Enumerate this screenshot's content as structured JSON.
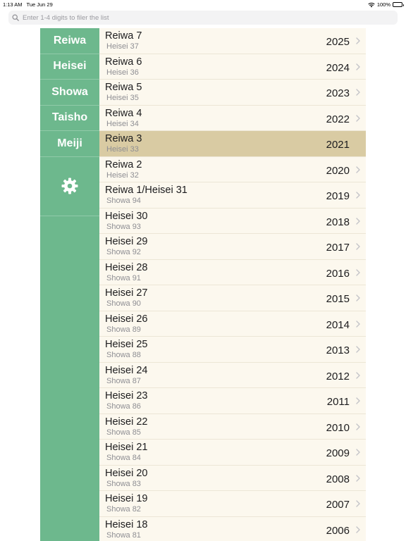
{
  "status": {
    "time": "1:13 AM",
    "date": "Tue Jun 29",
    "battery": "100%"
  },
  "search": {
    "placeholder": "Enter 1-4 digits to filer the list"
  },
  "sidebar": {
    "eras": [
      {
        "label": "Reiwa"
      },
      {
        "label": "Heisei"
      },
      {
        "label": "Showa"
      },
      {
        "label": "Taisho"
      },
      {
        "label": "Meiji"
      }
    ],
    "settings_icon": "gear-icon"
  },
  "colors": {
    "sidebar": "#6db88d",
    "row": "#fcf8ee",
    "selected_row": "#d9cba3"
  },
  "rows": [
    {
      "primary": "Reiwa 7",
      "secondary": "Heisei 37",
      "year": "2025",
      "selected": false
    },
    {
      "primary": "Reiwa 6",
      "secondary": "Heisei 36",
      "year": "2024",
      "selected": false
    },
    {
      "primary": "Reiwa 5",
      "secondary": "Heisei 35",
      "year": "2023",
      "selected": false
    },
    {
      "primary": "Reiwa 4",
      "secondary": "Heisei 34",
      "year": "2022",
      "selected": false
    },
    {
      "primary": "Reiwa 3",
      "secondary": "Heisei 33",
      "year": "2021",
      "selected": true
    },
    {
      "primary": "Reiwa 2",
      "secondary": "Heisei 32",
      "year": "2020",
      "selected": false
    },
    {
      "primary": "Reiwa 1/Heisei 31",
      "secondary": "Showa 94",
      "year": "2019",
      "selected": false
    },
    {
      "primary": "Heisei 30",
      "secondary": "Showa 93",
      "year": "2018",
      "selected": false
    },
    {
      "primary": "Heisei 29",
      "secondary": "Showa 92",
      "year": "2017",
      "selected": false
    },
    {
      "primary": "Heisei 28",
      "secondary": "Showa 91",
      "year": "2016",
      "selected": false
    },
    {
      "primary": "Heisei 27",
      "secondary": "Showa 90",
      "year": "2015",
      "selected": false
    },
    {
      "primary": "Heisei 26",
      "secondary": "Showa 89",
      "year": "2014",
      "selected": false
    },
    {
      "primary": "Heisei 25",
      "secondary": "Showa 88",
      "year": "2013",
      "selected": false
    },
    {
      "primary": "Heisei 24",
      "secondary": "Showa 87",
      "year": "2012",
      "selected": false
    },
    {
      "primary": "Heisei 23",
      "secondary": "Showa 86",
      "year": "2011",
      "selected": false
    },
    {
      "primary": "Heisei 22",
      "secondary": "Showa 85",
      "year": "2010",
      "selected": false
    },
    {
      "primary": "Heisei 21",
      "secondary": "Showa 84",
      "year": "2009",
      "selected": false
    },
    {
      "primary": "Heisei 20",
      "secondary": "Showa 83",
      "year": "2008",
      "selected": false
    },
    {
      "primary": "Heisei 19",
      "secondary": "Showa 82",
      "year": "2007",
      "selected": false
    },
    {
      "primary": "Heisei 18",
      "secondary": "Showa 81",
      "year": "2006",
      "selected": false
    }
  ]
}
